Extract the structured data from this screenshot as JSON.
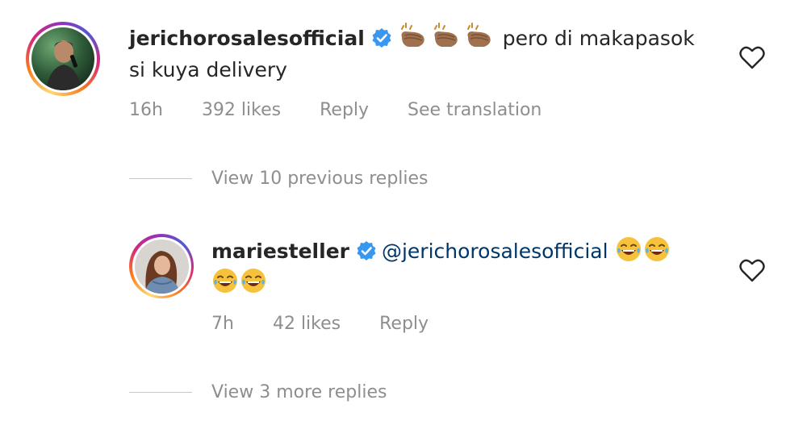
{
  "comments": [
    {
      "username": "jerichorosalesofficial",
      "verified": true,
      "emojis_before": [
        "clap-emoji",
        "clap-emoji",
        "clap-emoji"
      ],
      "text_line1": "pero di makapasok",
      "text_line2": "si kuya delivery",
      "time": "16h",
      "likes": "392 likes",
      "reply_label": "Reply",
      "translation_label": "See translation"
    },
    {
      "username": "mariesteller",
      "verified": true,
      "mention": "@jerichorosalesofficial",
      "emojis": [
        "joy-emoji",
        "joy-emoji",
        "joy-emoji",
        "joy-emoji"
      ],
      "time": "7h",
      "likes": "42 likes",
      "reply_label": "Reply"
    }
  ],
  "view_previous_replies": "View 10 previous replies",
  "view_more_replies": "View 3 more replies",
  "colors": {
    "text": "#262626",
    "muted": "#8e8e8e",
    "mention": "#00376b",
    "verified": "#3897f0"
  }
}
